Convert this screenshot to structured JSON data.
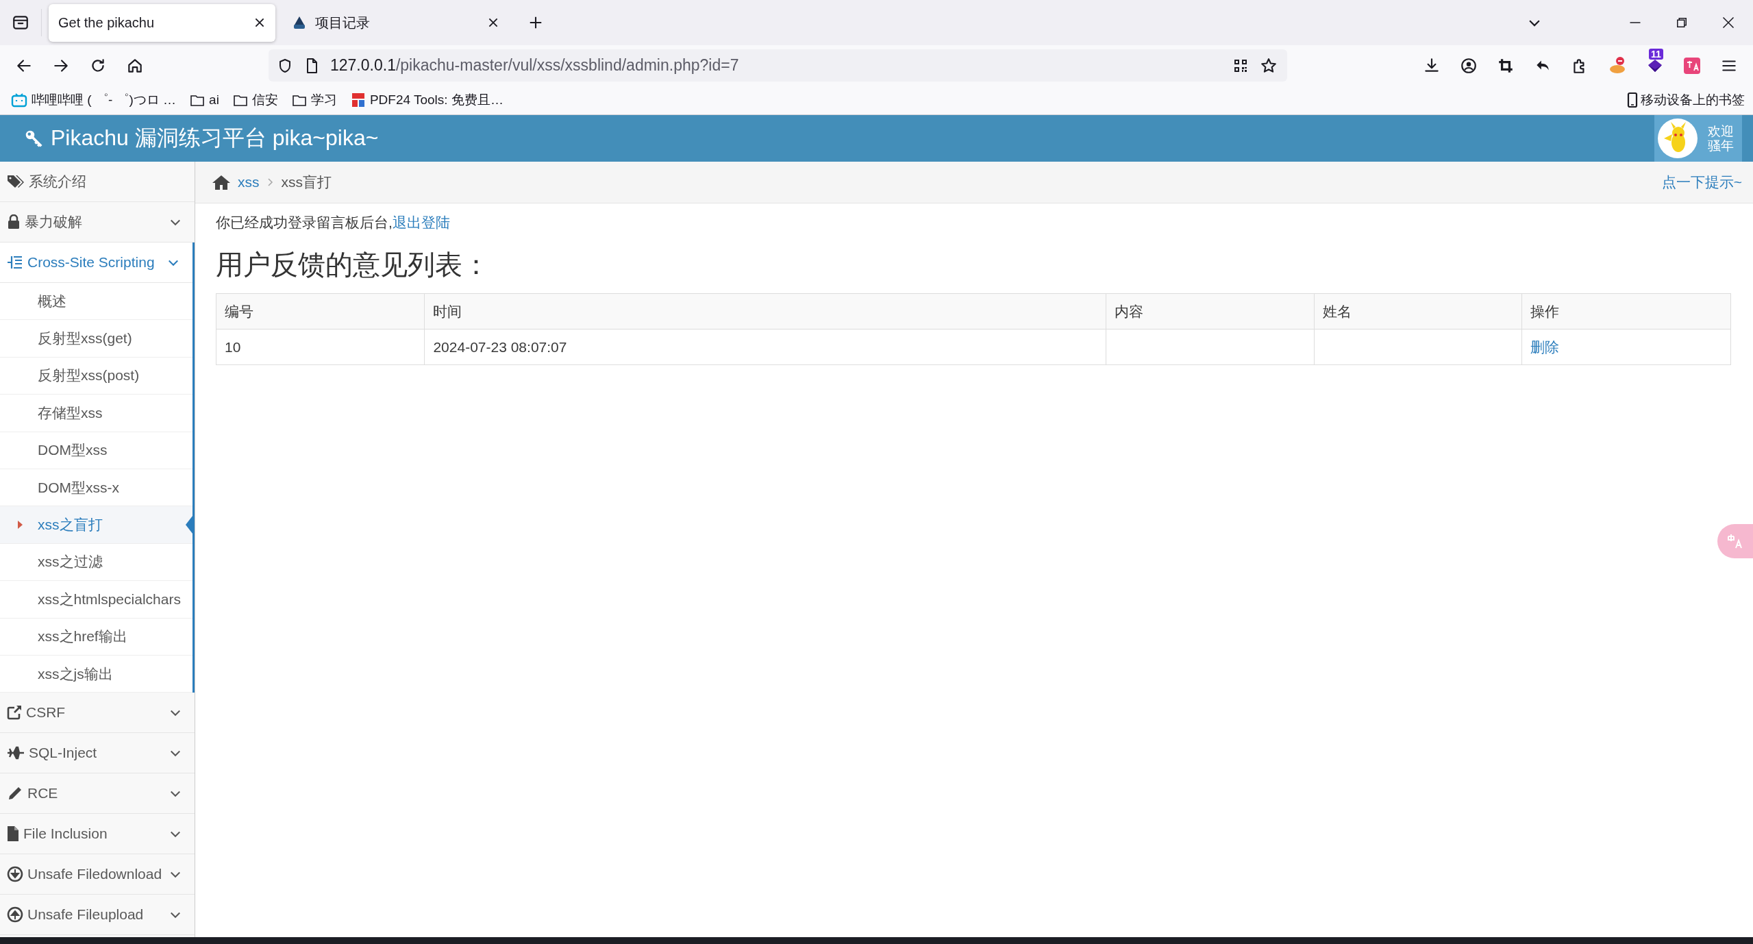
{
  "browser": {
    "tabs": [
      {
        "title": "Get the pikachu",
        "selected": true
      },
      {
        "title": "项目记录",
        "selected": false
      }
    ],
    "address": {
      "host": "127.0.0.1",
      "path": "/pikachu-master/vul/xss/xssblind/admin.php?id=7"
    },
    "bookmarks": [
      {
        "label": "哔哩哔哩 ( ゜- ゜)つロ …",
        "kind": "site"
      },
      {
        "label": "ai",
        "kind": "folder"
      },
      {
        "label": "信安",
        "kind": "folder"
      },
      {
        "label": "学习",
        "kind": "folder"
      },
      {
        "label": "PDF24 Tools: 免费且…",
        "kind": "pdf"
      }
    ],
    "mobile_bookmarks": "移动设备上的书签",
    "extension_badge": "11"
  },
  "header": {
    "title": "Pikachu 漏洞练习平台 pika~pika~",
    "greeting": [
      "欢迎",
      "骚年"
    ]
  },
  "sidebar": {
    "items": [
      {
        "label": "系统介绍",
        "kind": "link"
      },
      {
        "label": "暴力破解",
        "kind": "menu",
        "expanded": false
      },
      {
        "label": "Cross-Site Scripting",
        "kind": "menu",
        "expanded": true,
        "children": [
          {
            "label": "概述",
            "selected": false
          },
          {
            "label": "反射型xss(get)",
            "selected": false
          },
          {
            "label": "反射型xss(post)",
            "selected": false
          },
          {
            "label": "存储型xss",
            "selected": false
          },
          {
            "label": "DOM型xss",
            "selected": false
          },
          {
            "label": "DOM型xss-x",
            "selected": false
          },
          {
            "label": "xss之盲打",
            "selected": true
          },
          {
            "label": "xss之过滤",
            "selected": false
          },
          {
            "label": "xss之htmlspecialchars",
            "selected": false
          },
          {
            "label": "xss之href输出",
            "selected": false
          },
          {
            "label": "xss之js输出",
            "selected": false
          }
        ]
      },
      {
        "label": "CSRF",
        "kind": "menu",
        "expanded": false
      },
      {
        "label": "SQL-Inject",
        "kind": "menu",
        "expanded": false
      },
      {
        "label": "RCE",
        "kind": "menu",
        "expanded": false
      },
      {
        "label": "File Inclusion",
        "kind": "menu",
        "expanded": false
      },
      {
        "label": "Unsafe Filedownload",
        "kind": "menu",
        "expanded": false
      },
      {
        "label": "Unsafe Fileupload",
        "kind": "menu",
        "expanded": false
      }
    ]
  },
  "breadcrumb": {
    "items": [
      "xss",
      "xss盲打"
    ],
    "hint": "点一下提示~"
  },
  "content": {
    "notice": "你已经成功登录留言板后台,",
    "logout_link": "退出登陆",
    "heading": "用户反馈的意见列表：",
    "table": {
      "columns": [
        "编号",
        "时间",
        "内容",
        "姓名",
        "操作"
      ],
      "rows": [
        {
          "id": "10",
          "time": "2024-07-23 08:07:07",
          "action": "删除"
        }
      ]
    }
  }
}
